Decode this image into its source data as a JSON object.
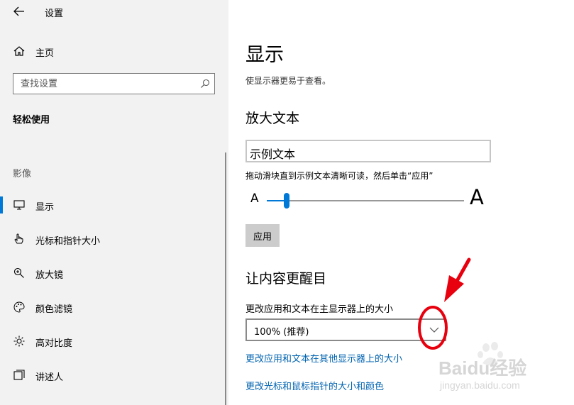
{
  "window": {
    "title": "设置"
  },
  "sidebar": {
    "home_label": "主页",
    "search_placeholder": "查找设置",
    "section_title": "轻松使用",
    "group_label": "影像",
    "items": [
      {
        "label": "显示",
        "icon": "monitor-icon",
        "selected": true
      },
      {
        "label": "光标和指针大小",
        "icon": "pointer-hand-icon",
        "selected": false
      },
      {
        "label": "放大镜",
        "icon": "magnifier-icon",
        "selected": false
      },
      {
        "label": "颜色滤镜",
        "icon": "palette-icon",
        "selected": false
      },
      {
        "label": "高对比度",
        "icon": "brightness-icon",
        "selected": false
      },
      {
        "label": "讲述人",
        "icon": "narrator-icon",
        "selected": false
      }
    ]
  },
  "main": {
    "title": "显示",
    "description": "使显示器更易于查看。",
    "enlarge_text": {
      "heading": "放大文本",
      "sample_text": "示例文本",
      "hint": "拖动滑块直到示例文本清晰可读，然后单击“应用”",
      "small_a": "A",
      "large_a": "A",
      "slider_value_fraction": 0.1,
      "apply_label": "应用"
    },
    "make_stand_out": {
      "heading": "让内容更醒目",
      "scale_label": "更改应用和文本在主显示器上的大小",
      "scale_value": "100% (推荐)",
      "links": [
        "更改应用和文本在其他显示器上的大小",
        "更改光标和鼠标指针的大小和颜色"
      ]
    }
  },
  "watermark": {
    "brand": "Baidu经验",
    "url": "jingyan.baidu.com"
  },
  "colors": {
    "accent": "#0078d7",
    "link": "#0063b1",
    "sidebar_bg": "#f2f2f2",
    "annotation_red": "#e8000e"
  }
}
